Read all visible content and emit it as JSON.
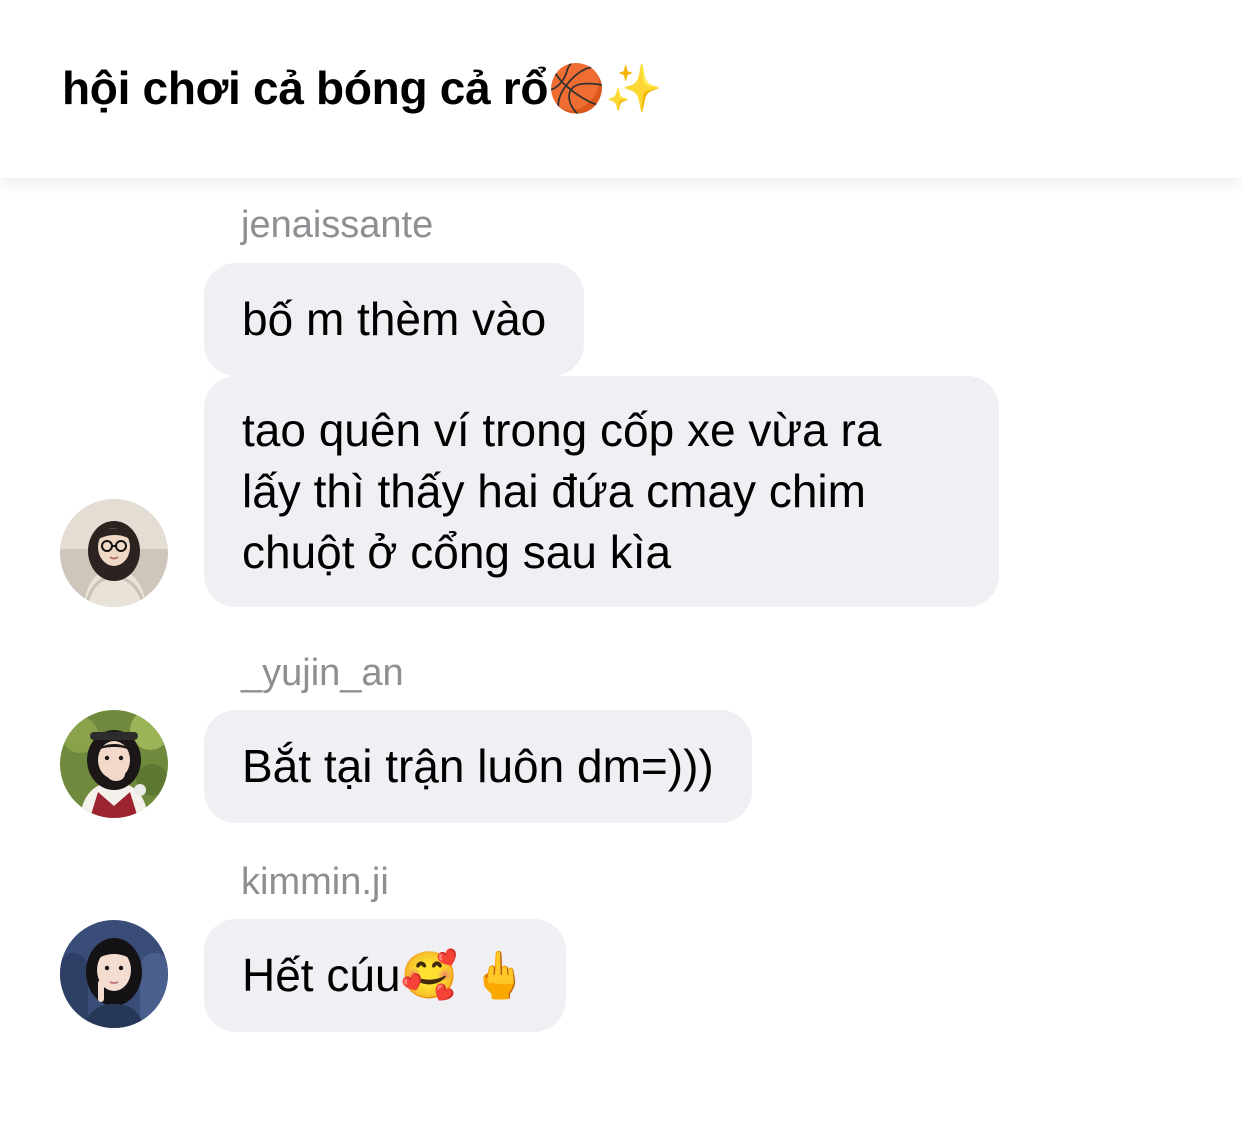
{
  "header": {
    "title": "hội chơi cả bóng cả rổ🏀✨"
  },
  "messages": [
    {
      "sender": "jenaissante",
      "bubbles": [
        "bố m thèm vào"
      ]
    },
    {
      "sender": "",
      "bubbles": [
        "tao quên ví trong cốp xe vừa ra",
        "lấy thì thấy hai đứa cmay chim",
        "chuột ở cổng sau kìa"
      ]
    },
    {
      "sender": "_yujin_an",
      "bubbles": [
        "Bắt tại trận luôn dm=)))"
      ]
    },
    {
      "sender": "kimmin.ji",
      "bubbles": [
        "Hết cúu🥰 🖕"
      ]
    }
  ],
  "colors": {
    "bubble_bg": "#efeff4",
    "sender_text": "#8e8e93",
    "text": "#000000",
    "background": "#ffffff"
  }
}
